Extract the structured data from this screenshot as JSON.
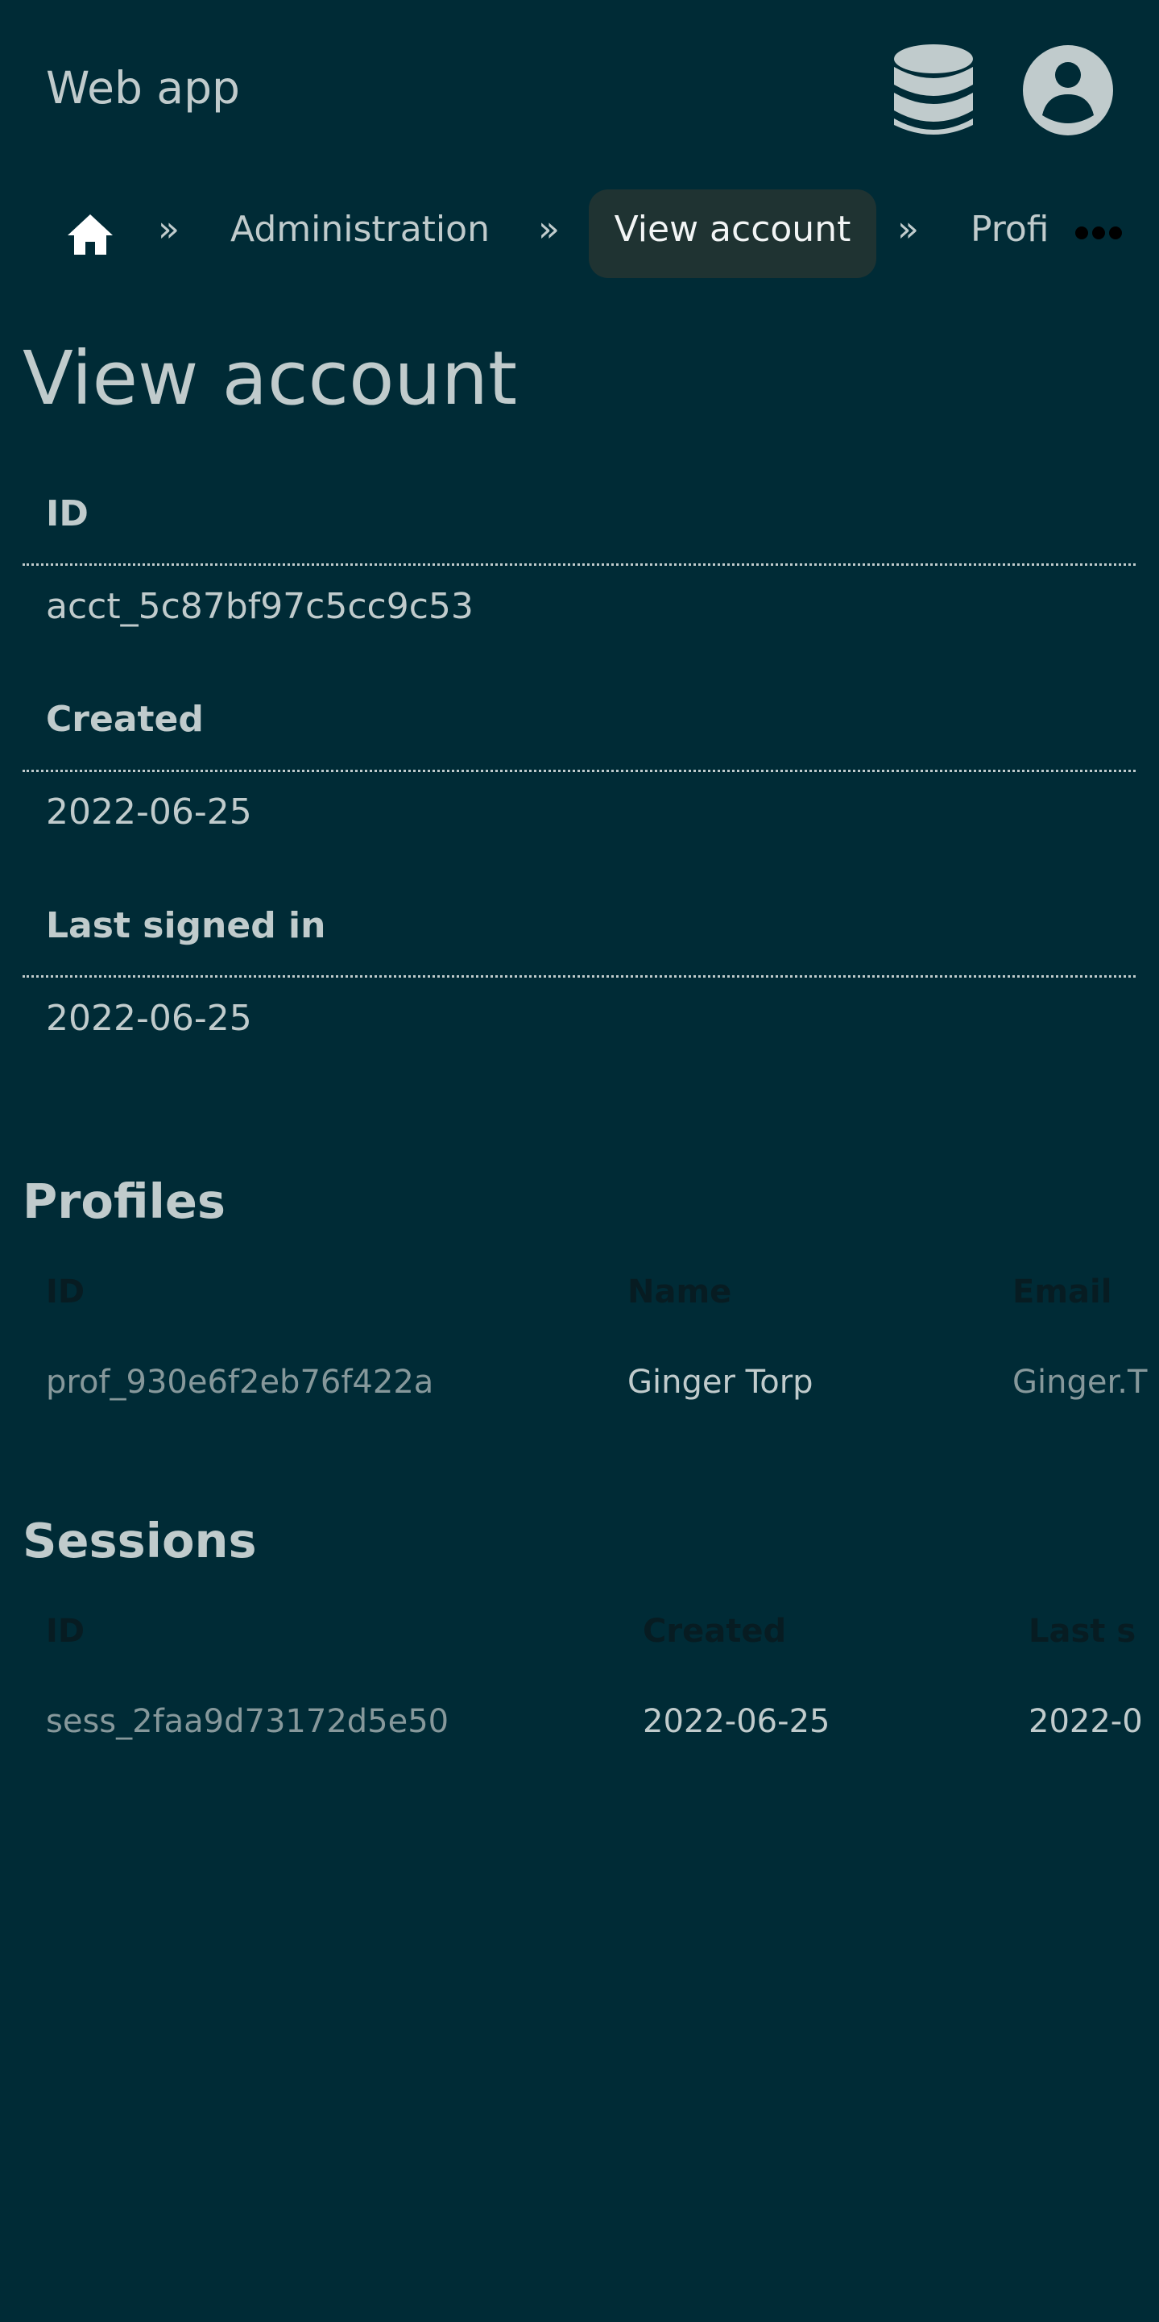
{
  "header": {
    "title": "Web app",
    "icons": [
      "database-icon",
      "user-circle-icon"
    ]
  },
  "breadcrumb": {
    "home_icon": "home-icon",
    "separator": "»",
    "items": [
      "Administration",
      "View account",
      "Profi"
    ],
    "more_icon": "ellipsis-icon"
  },
  "page": {
    "title": "View account"
  },
  "details": [
    {
      "label": "ID",
      "value": "acct_5c87bf97c5cc9c53"
    },
    {
      "label": "Created",
      "value": "2022-06-25"
    },
    {
      "label": "Last signed in",
      "value": "2022-06-25"
    }
  ],
  "profiles": {
    "title": "Profiles",
    "columns": [
      "ID",
      "Name",
      "Email"
    ],
    "rows": [
      [
        "prof_930e6f2eb76f422a",
        "Ginger Torp",
        "Ginger.T"
      ]
    ]
  },
  "sessions": {
    "title": "Sessions",
    "columns": [
      "ID",
      "Created",
      "Last s"
    ],
    "rows": [
      [
        "sess_2faa9d73172d5e50",
        "2022-06-25",
        "2022-0"
      ]
    ]
  },
  "colors": {
    "background": "#002b36",
    "text": "#c0cbcc",
    "pill": "#1f3332"
  }
}
